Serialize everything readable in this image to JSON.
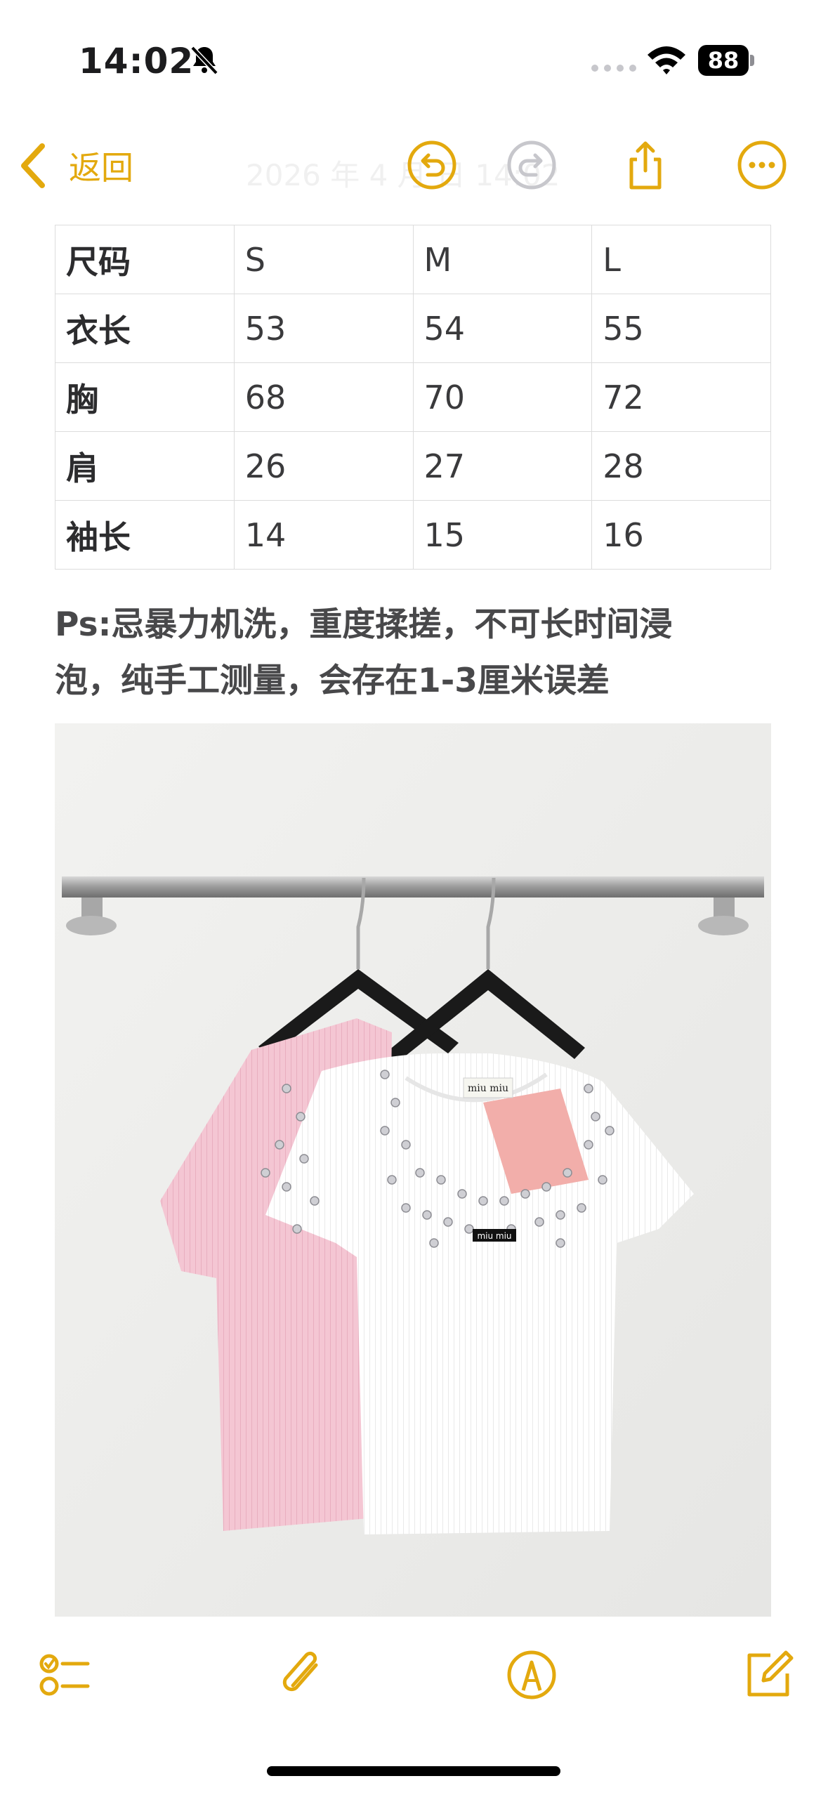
{
  "status_bar": {
    "time": "14:02",
    "battery": "88"
  },
  "nav": {
    "back_label": "返回",
    "faded_title": "2026 年 4 月  日  14:02"
  },
  "size_table": {
    "rows": [
      [
        "尺码",
        "S",
        "M",
        "L"
      ],
      [
        "衣长",
        "53",
        "54",
        "55"
      ],
      [
        "胸",
        "68",
        "70",
        "72"
      ],
      [
        "肩",
        "26",
        "27",
        "28"
      ],
      [
        "袖长",
        "14",
        "15",
        "16"
      ]
    ]
  },
  "note": {
    "line1": "Ps:忌暴力机洗，重度揉搓，不可长时间浸",
    "line2": "泡，纯手工测量，会存在1-3厘米误差"
  },
  "photo": {
    "tag_text": "miu miu",
    "label_text": "miu miu"
  },
  "icons": {
    "back": "chevron-left-icon",
    "undo": "undo-icon",
    "redo": "redo-icon",
    "share": "share-icon",
    "more": "more-icon",
    "checklist": "checklist-icon",
    "attach": "paperclip-icon",
    "markup": "markup-pen-icon",
    "compose": "compose-icon"
  },
  "colors": {
    "accent": "#e3a90e",
    "disabled": "#c7c7cc"
  }
}
